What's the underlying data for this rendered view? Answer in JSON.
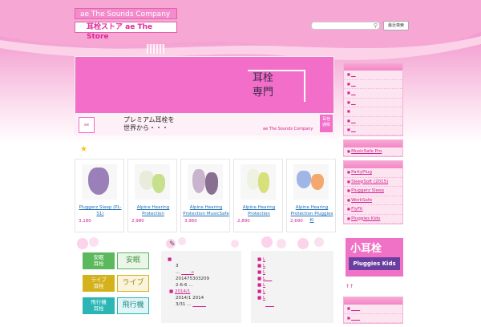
{
  "header": {
    "company": "ae The Sounds Company",
    "store": "耳栓ストア ae The Store",
    "search_placeholder": "",
    "search_button": "最近検索"
  },
  "banner": {
    "kanji_line1": "耳栓",
    "kanji_line2": "専門",
    "logo_text": "ae",
    "copy_line1": "プレミアム耳栓を",
    "copy_line2": "世界から・・・",
    "company": "ae The Sounds Company",
    "tag_line1": "耳栓",
    "tag_line2": "通販"
  },
  "products": [
    {
      "name": "Pluggerz Sleep (PL-S1)",
      "price": "3,180",
      "color": "#9b7fb8"
    },
    {
      "name": "Alpine Hearing Protection",
      "price": "2,980",
      "color": "#b8d96b"
    },
    {
      "name": "Alpine Hearing Protection MusicSafe",
      "price": "3,960",
      "color": "#a48aa8"
    },
    {
      "name": "Alpine Hearing Protection",
      "price": "2,890",
      "color": "#d7e07a"
    },
    {
      "name": "Alpine Hearing Protection Pluggies Ki",
      "price": "2,690",
      "color": "#9fb6e6"
    }
  ],
  "categories": [
    {
      "a1": "安眠",
      "a2": "耳栓",
      "b": "安眠",
      "color": "#5cb85c"
    },
    {
      "a1": "ライブ",
      "a2": "耳栓",
      "b": "ライブ",
      "color": "#d4b21c"
    },
    {
      "a1": "飛行機",
      "a2": "耳栓",
      "b": "飛行機",
      "color": "#2bb5b5"
    }
  ],
  "news_left": [
    "3",
    "…",
    "201475303209",
    "2-6-6 …",
    "2014/1",
    "2014/1 2014",
    "3/31 …"
  ],
  "news_left_links": [
    "____→",
    "______"
  ],
  "news_right": [
    "L",
    "L",
    "L",
    "L___",
    "L",
    "L",
    "L",
    "____"
  ],
  "sidebar": {
    "box1": [
      "__",
      "__",
      "__",
      "__",
      "",
      "__",
      "__"
    ],
    "box2": [
      "MusicSafe Pro"
    ],
    "box3": [
      "PartyPlug",
      "SleepSoft (2015)",
      "Pluggerz Sleep",
      "WorkSafe",
      "FlyFit",
      "Pluggies Kids"
    ],
    "kids_title": "小耳栓",
    "kids_brand": "Pluggies Kids",
    "ear_text": "↑↑",
    "box4": [
      "____",
      "____"
    ]
  },
  "colors": {
    "brand": "#f26ec9",
    "link": "#d0228e"
  }
}
